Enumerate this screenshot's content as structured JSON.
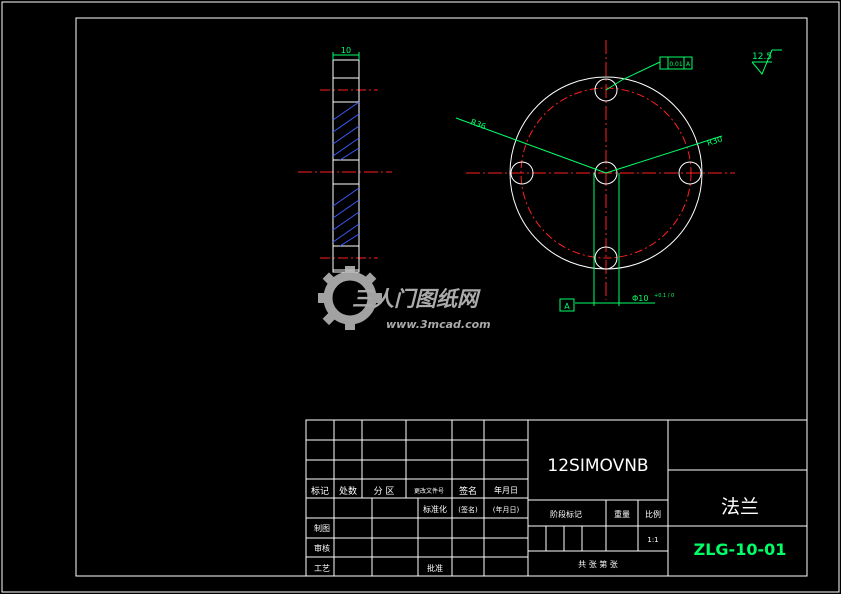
{
  "drawing": {
    "dims": {
      "thickness": "10",
      "hole_pcd": "R36",
      "outer_r": "R30",
      "bore": "Φ10",
      "bore_tol": "+0.1 / 0",
      "datum": "A",
      "tolerance_value": "0.01",
      "tolerance_ref": "A"
    },
    "roughness": "12.5",
    "colors": {
      "outline": "#ffffff",
      "centerline": "#ff2020",
      "dimension": "#00ff66",
      "hatch": "#3a5bff",
      "title_green": "#00ff66"
    }
  },
  "watermark": {
    "brand": "三人门图纸网",
    "url": "www.3mcad.com"
  },
  "title_block": {
    "row_labels": [
      "标记",
      "处数",
      "分 区",
      "更改文件号",
      "签名",
      "年月日"
    ],
    "std_labels": [
      "标准化",
      "(签名)",
      "(年月日)"
    ],
    "left_labels": [
      "制图",
      "审核",
      "工艺"
    ],
    "approve": "批准",
    "material": "12SIMOVNB",
    "stage_label": "阶段标记",
    "weight_label": "重量",
    "scale_label": "比例",
    "scale_value": "1:1",
    "sheets": "共 张  第 张",
    "part_name": "法兰",
    "drawing_no": "ZLG-10-01"
  }
}
